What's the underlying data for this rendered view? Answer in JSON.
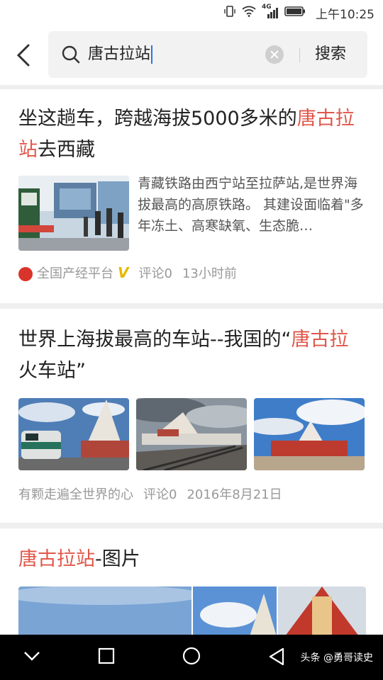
{
  "status": {
    "network": "4G",
    "time": "上午10:25"
  },
  "search": {
    "query": "唐古拉站",
    "button_label": "搜索"
  },
  "results": [
    {
      "title_before": "坐这趟车，跨越海拔5000多米的",
      "title_highlight": "唐古拉站",
      "title_after": "去西藏",
      "snippet": "青藏铁路由西宁站至拉萨站,是世界海拔最高的高原铁路。 其建设面临着\"多年冻土、高寒缺氧、生态脆…",
      "source": "全国产经平台",
      "source_badge": "V",
      "comments": "评论0",
      "time": "13小时前"
    },
    {
      "title_before": "世界上海拔最高的车站--我国的“",
      "title_highlight": "唐古拉",
      "title_after": "火车站”",
      "source": "有颗走遍全世界的心",
      "comments": "评论0",
      "time": "2016年8月21日"
    },
    {
      "title_highlight": "唐古拉站",
      "title_after": "-图片"
    }
  ],
  "watermark": "头条 @勇哥读史",
  "colors": {
    "highlight": "#e0574a",
    "meta": "#999999",
    "divider": "#efefef"
  }
}
